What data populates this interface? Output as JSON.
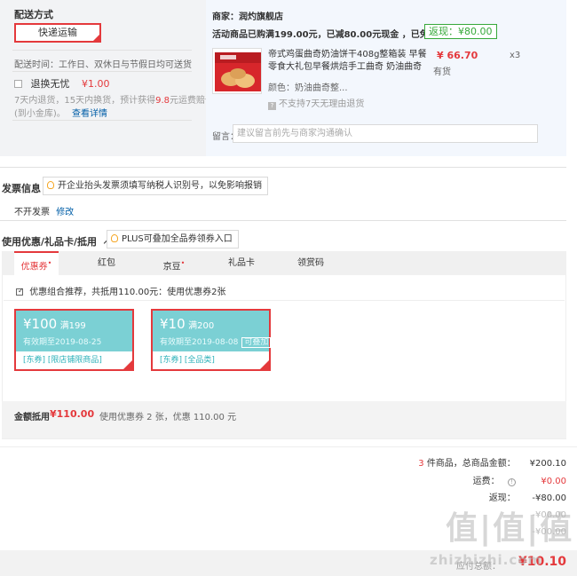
{
  "shipping": {
    "title": "配送方式",
    "express_label": "快递运输",
    "delivery_time": "配送时间：工作日、双休日与节假日均可送货",
    "return_worry_label": "退换无忧",
    "return_worry_price": "¥1.00",
    "return_desc_1": "7天内退货，15天内换货，预计获得",
    "return_desc_amount": "9.8",
    "return_desc_2": "元运费赔付",
    "return_desc_3": "(到小金库)。",
    "view_details": "查看详情"
  },
  "order": {
    "merchant": "商家：润灼旗舰店",
    "promo": "活动商品已购满199.00元，已减80.00元现金 ，已免邮",
    "fanli": "返现：¥80.00",
    "product_title_1": "帝式鸡蛋曲奇奶油饼干408g整箱装 早餐",
    "product_title_2": "零食大礼包早餐烘焙手工曲奇 奶油曲奇",
    "color": "颜色：奶油曲奇整...",
    "price": "¥ 66.70",
    "stock": "有货",
    "qty": "x3",
    "no_return": "不支持7天无理由退货",
    "message_label": "留言：",
    "message_placeholder": "建议留言前先与商家沟通确认"
  },
  "invoice": {
    "title": "发票信息",
    "tip": "开企业抬头发票须填写纳税人识别号，以免影响报销",
    "value": "不开发票",
    "edit": "修改"
  },
  "coupons": {
    "title": "使用优惠/礼品卡/抵用",
    "plus_tip": "PLUS可叠加全品券领券入口",
    "tabs": [
      "优惠券",
      "红包",
      "京豆",
      "礼品卡",
      "领赏码"
    ],
    "recommend": "优惠组合推荐，共抵用110.00元：使用优惠券2张",
    "items": [
      {
        "amount": "¥100",
        "cond": "满199",
        "expire": "有效期至2019-08-25",
        "scope": "[东券]  [限店铺限商品]"
      },
      {
        "amount": "¥10",
        "cond": "满200",
        "expire": "有效期至2019-08-08",
        "stack": "可叠加",
        "scope": "[东券]  [全品类]"
      }
    ],
    "offset_label": "金额抵用",
    "offset_amount": "¥110.00",
    "offset_desc": "使用优惠券 2 张，优惠 110.00 元"
  },
  "summary": {
    "count": "3",
    "count_label": "件商品，总商品金额：",
    "total": "¥200.10",
    "freight_label": "运费：",
    "freight": "¥0.00",
    "fanli_label": "返现：",
    "fanli": "-¥80.00",
    "row4_label": "",
    "row4_value": "-¥00.00",
    "row5_label": "",
    "row5_value": "-¥00.00",
    "pay_label": "应付总额：",
    "pay": "¥10.10"
  },
  "watermark": {
    "logo": "值|值|值",
    "site": "zhizhizhi.com"
  },
  "colors": {
    "accent": "#e4393c",
    "coupon": "#7bd0d4",
    "link": "#005ea7",
    "fanli": "#36a83a"
  }
}
